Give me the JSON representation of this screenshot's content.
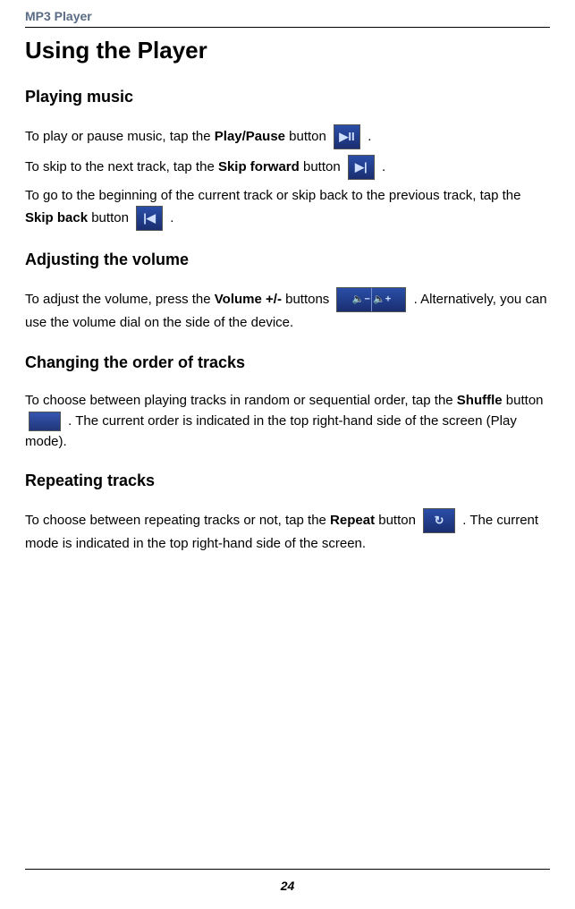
{
  "header": {
    "title": "MP3 Player"
  },
  "h1": "Using the Player",
  "playing": {
    "heading": "Playing music",
    "p1a": "To play or pause music, tap the ",
    "p1b": "Play/Pause",
    "p1c": " button  ",
    "p1d": " .",
    "p2a": "To skip to the next track, tap the ",
    "p2b": "Skip forward",
    "p2c": " button  ",
    "p2d": " .",
    "p3a": "To go to the beginning of the current track or skip back to the previous track, tap the ",
    "p3b": "Skip back",
    "p3c": " button  ",
    "p3d": " ."
  },
  "volume": {
    "heading": "Adjusting the volume",
    "p1a": "To adjust the volume, press the ",
    "p1b": "Volume +/-",
    "p1c": " buttons  ",
    "p1d": " . Alternatively, you can use the volume dial on the side of the device."
  },
  "order": {
    "heading": "Changing the order of tracks",
    "p1a": "To choose between playing tracks in random or sequential order, tap the ",
    "p1b": "Shuffle",
    "p1c": " button ",
    "p1d": " . The current order is indicated in the top right-hand side of the screen (Play mode)."
  },
  "repeat": {
    "heading": "Repeating tracks",
    "p1a": "To choose between repeating tracks or not, tap the ",
    "p1b": "Repeat",
    "p1c": " button   ",
    "p1d": " . The current mode is indicated in the top right-hand side of the screen."
  },
  "icons": {
    "playpause": "▶II",
    "forward": "▶|",
    "back": "|◀",
    "volume": "🔈− 🔈+",
    "shuffle": "",
    "repeat": "↻"
  },
  "page_number": "24"
}
